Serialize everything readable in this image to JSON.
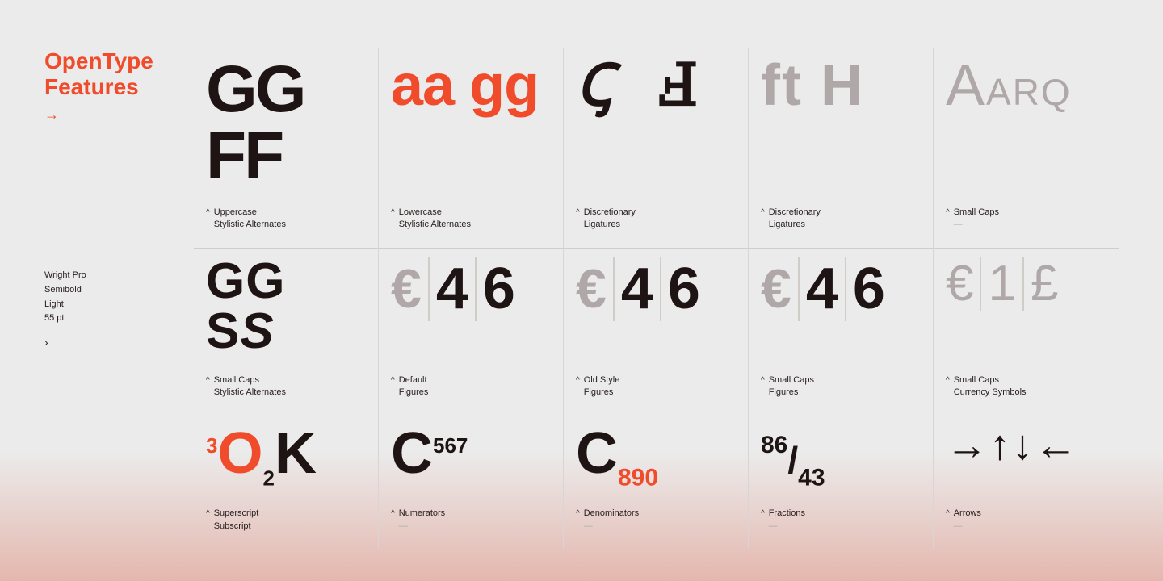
{
  "sidebar": {
    "title": "OpenType\nFeatures",
    "arrow": "→",
    "font_name": "Wright Pro",
    "font_weight": "Semibold",
    "font_style": "Light",
    "font_size": "55 pt",
    "chevron": "›"
  },
  "features": {
    "row1": [
      {
        "display": "GG FF",
        "label1": "Uppercase",
        "label2": "Stylistic Alternates",
        "caret": "^"
      },
      {
        "display": "aa gg",
        "label1": "Lowercase",
        "label2": "Stylistic Alternates",
        "caret": "^"
      },
      {
        "display": "Ct Ft",
        "label1": "Discretionary",
        "label2": "Ligatures",
        "caret": "^"
      },
      {
        "display": "ft H",
        "label1": "Discretionary",
        "label2": "Ligatures",
        "caret": "^"
      },
      {
        "display": "A ARQ",
        "label1": "Small Caps",
        "label2": "—",
        "caret": "^"
      }
    ],
    "row2": [
      {
        "display": "GG SS",
        "label1": "Small Caps",
        "label2": "Stylistic Alternates",
        "caret": "^"
      },
      {
        "display": "€ 4 6",
        "label1": "Default",
        "label2": "Figures",
        "caret": "^"
      },
      {
        "display": "€ 4 6",
        "label1": "Old Style",
        "label2": "Figures",
        "caret": "^"
      },
      {
        "display": "€ 4 6",
        "label1": "Small Caps",
        "label2": "Figures",
        "caret": "^"
      },
      {
        "display": "€ 1 £",
        "label1": "Small Caps",
        "label2": "Currency Symbols",
        "caret": "^"
      }
    ],
    "row3": [
      {
        "display": "³O₂K",
        "label1": "Superscript",
        "label2": "Subscript",
        "caret": "^"
      },
      {
        "display": "C⁵⁶⁷",
        "label1": "Numerators",
        "label2": "—",
        "caret": "^"
      },
      {
        "display": "C₈₉₀",
        "label1": "Denominators",
        "label2": "—",
        "caret": "^"
      },
      {
        "display": "⁸⁶/₄₃",
        "label1": "Fractions",
        "label2": "—",
        "caret": "^"
      },
      {
        "display": "→↑↓←",
        "label1": "Arrows",
        "label2": "—",
        "caret": "^"
      }
    ]
  }
}
